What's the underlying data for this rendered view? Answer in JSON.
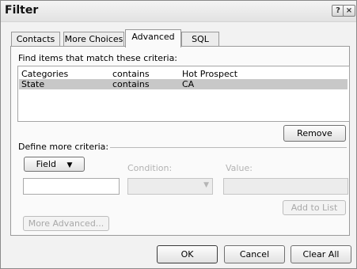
{
  "window": {
    "title": "Filter"
  },
  "tabs": [
    {
      "label": "Contacts"
    },
    {
      "label": "More Choices"
    },
    {
      "label": "Advanced"
    },
    {
      "label": "SQL"
    }
  ],
  "criteria": {
    "heading": "Find items that match these criteria:",
    "rows": [
      {
        "field": "Categories",
        "condition": "contains",
        "value": "Hot Prospect"
      },
      {
        "field": "State",
        "condition": "contains",
        "value": "CA"
      }
    ]
  },
  "buttons": {
    "remove": "Remove",
    "field": "Field",
    "add_to_list": "Add to List",
    "more_advanced": "More Advanced...",
    "ok": "OK",
    "cancel": "Cancel",
    "clear_all": "Clear All"
  },
  "define": {
    "heading": "Define more criteria:",
    "condition_label": "Condition:",
    "value_label": "Value:"
  }
}
